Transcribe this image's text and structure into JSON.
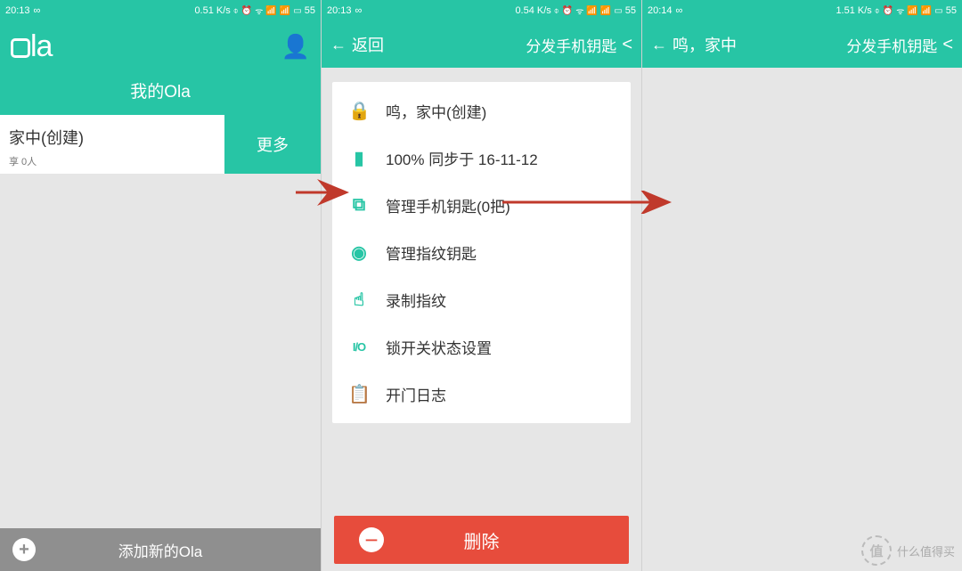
{
  "pane1": {
    "status": {
      "time": "20:13",
      "infinity": "∞",
      "speed": "0.51 K/s",
      "batt": "55"
    },
    "logo_text": "la",
    "header_sub": "我的Ola",
    "device": {
      "name": "家中(创建)",
      "sub": "享 0人",
      "more": "更多"
    },
    "add_bar": "添加新的Ola"
  },
  "pane2": {
    "status": {
      "time": "20:13",
      "infinity": "∞",
      "speed": "0.54 K/s",
      "batt": "55"
    },
    "nav": {
      "back": "返回",
      "title": "分发手机钥匙"
    },
    "rows": {
      "r0": "鸣，家中(创建)",
      "r1": "100% 同步于 16-11-12",
      "r2": "管理手机钥匙(0把)",
      "r3": "管理指纹钥匙",
      "r4": "录制指纹",
      "r5": "锁开关状态设置",
      "r6": "开门日志"
    },
    "delete": "删除"
  },
  "pane3": {
    "status": {
      "time": "20:14",
      "infinity": "∞",
      "speed": "1.51 K/s",
      "batt": "55"
    },
    "nav": {
      "back": "鸣，家中",
      "title": "分发手机钥匙"
    }
  },
  "watermark": {
    "badge": "值",
    "text": "什么值得买"
  }
}
